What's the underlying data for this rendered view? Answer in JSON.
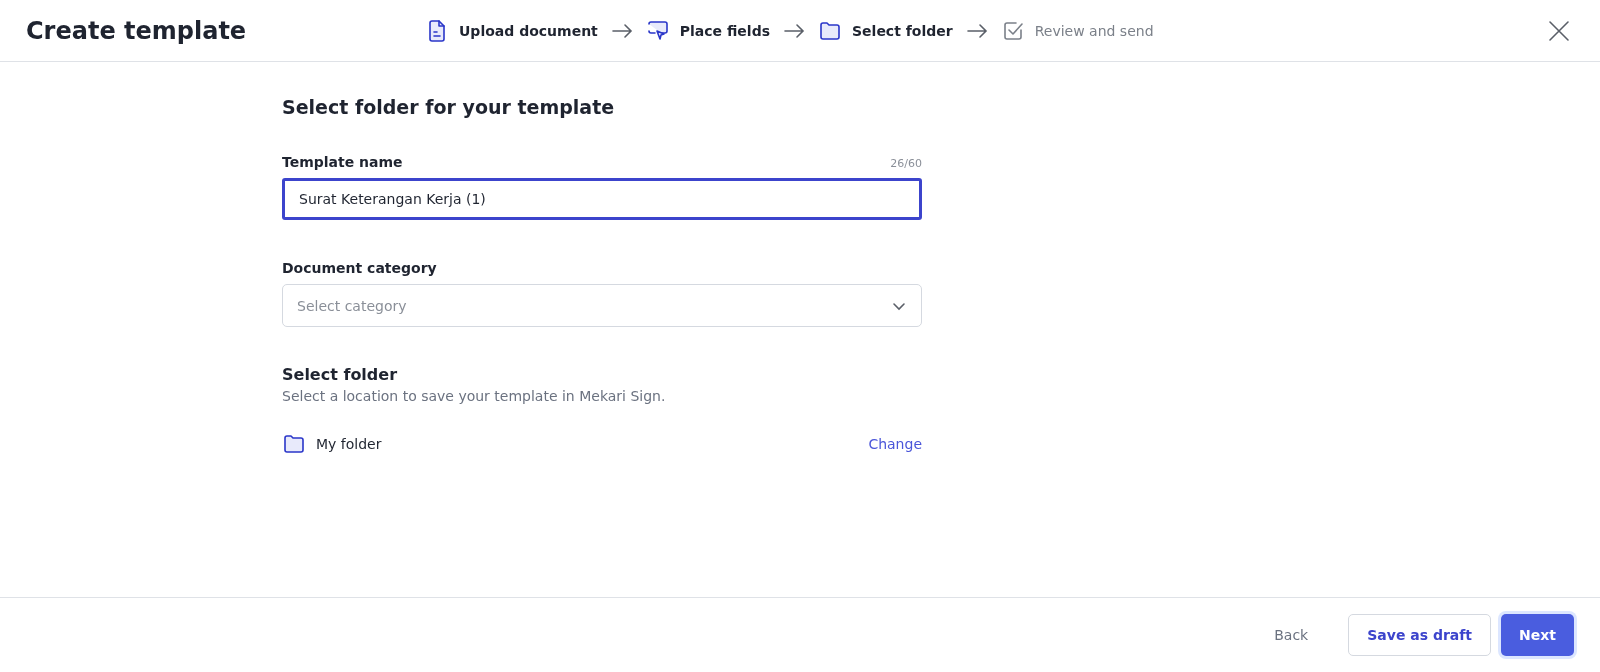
{
  "header": {
    "title": "Create template"
  },
  "steps": [
    {
      "label": "Upload document",
      "kind": "document",
      "disabled": false
    },
    {
      "label": "Place fields",
      "kind": "pointer",
      "disabled": false
    },
    {
      "label": "Select folder",
      "kind": "folder",
      "disabled": false
    },
    {
      "label": "Review and send",
      "kind": "check",
      "disabled": true
    }
  ],
  "section_title": "Select folder for your template",
  "template_name": {
    "label": "Template name",
    "counter": "26/60",
    "value": "Surat Keterangan Kerja (1)",
    "focused": true
  },
  "category": {
    "label": "Document category",
    "placeholder": "Select category"
  },
  "folder": {
    "title": "Select folder",
    "description": "Select a location to save your template in Mekari Sign.",
    "name": "My folder",
    "action": "Change"
  },
  "footer": {
    "back": "Back",
    "save_draft": "Save as draft",
    "next": "Next"
  }
}
